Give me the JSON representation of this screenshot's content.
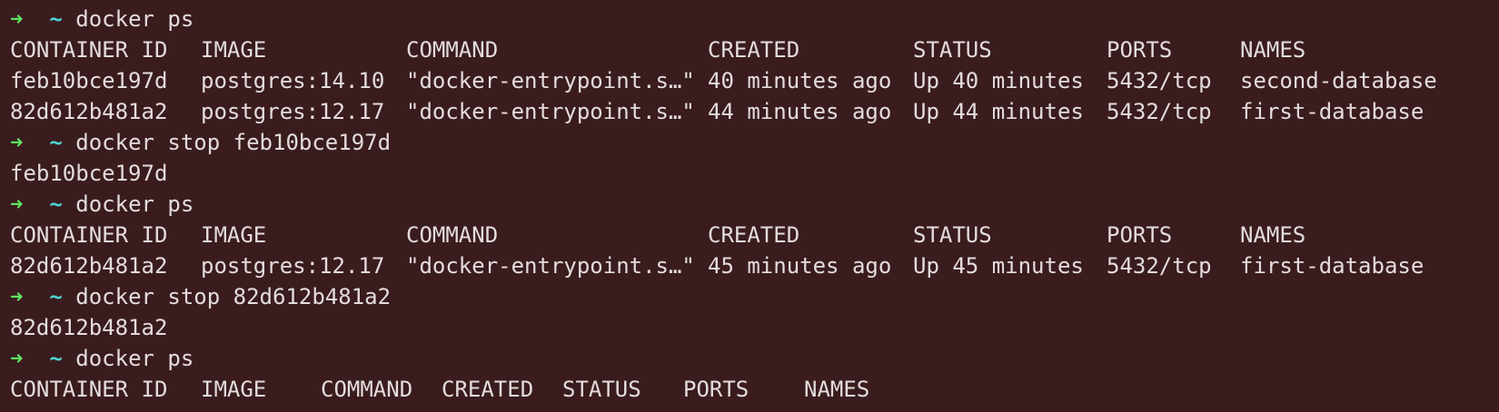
{
  "theme": {
    "background": "#3a1c1e",
    "foreground": "#e4dcdc",
    "prompt_arrow_color": "#5fe35f",
    "prompt_tilde_color": "#4fd4d4"
  },
  "prompt": {
    "arrow": "➜",
    "cwd": "~"
  },
  "lines": [
    {
      "type": "prompt",
      "command": "docker ps"
    },
    {
      "type": "header",
      "cols": [
        "CONTAINER ID",
        "IMAGE",
        "COMMAND",
        "CREATED",
        "STATUS",
        "PORTS",
        "NAMES"
      ]
    },
    {
      "type": "row",
      "cols": [
        "feb10bce197d",
        "postgres:14.10",
        "\"docker-entrypoint.s…\"",
        "40 minutes ago",
        "Up 40 minutes",
        "5432/tcp",
        "second-database"
      ]
    },
    {
      "type": "row",
      "cols": [
        "82d612b481a2",
        "postgres:12.17",
        "\"docker-entrypoint.s…\"",
        "44 minutes ago",
        "Up 44 minutes",
        "5432/tcp",
        "first-database"
      ]
    },
    {
      "type": "prompt",
      "command": "docker stop feb10bce197d"
    },
    {
      "type": "output",
      "text": "feb10bce197d"
    },
    {
      "type": "prompt",
      "command": "docker ps"
    },
    {
      "type": "header",
      "cols": [
        "CONTAINER ID",
        "IMAGE",
        "COMMAND",
        "CREATED",
        "STATUS",
        "PORTS",
        "NAMES"
      ]
    },
    {
      "type": "row",
      "cols": [
        "82d612b481a2",
        "postgres:12.17",
        "\"docker-entrypoint.s…\"",
        "45 minutes ago",
        "Up 45 minutes",
        "5432/tcp",
        "first-database"
      ]
    },
    {
      "type": "prompt",
      "command": "docker stop 82d612b481a2"
    },
    {
      "type": "output",
      "text": "82d612b481a2"
    },
    {
      "type": "prompt",
      "command": "docker ps"
    },
    {
      "type": "header-empty",
      "cols": [
        "CONTAINER ID",
        "IMAGE",
        "COMMAND",
        "CREATED",
        "STATUS",
        "PORTS",
        "NAMES"
      ]
    }
  ]
}
